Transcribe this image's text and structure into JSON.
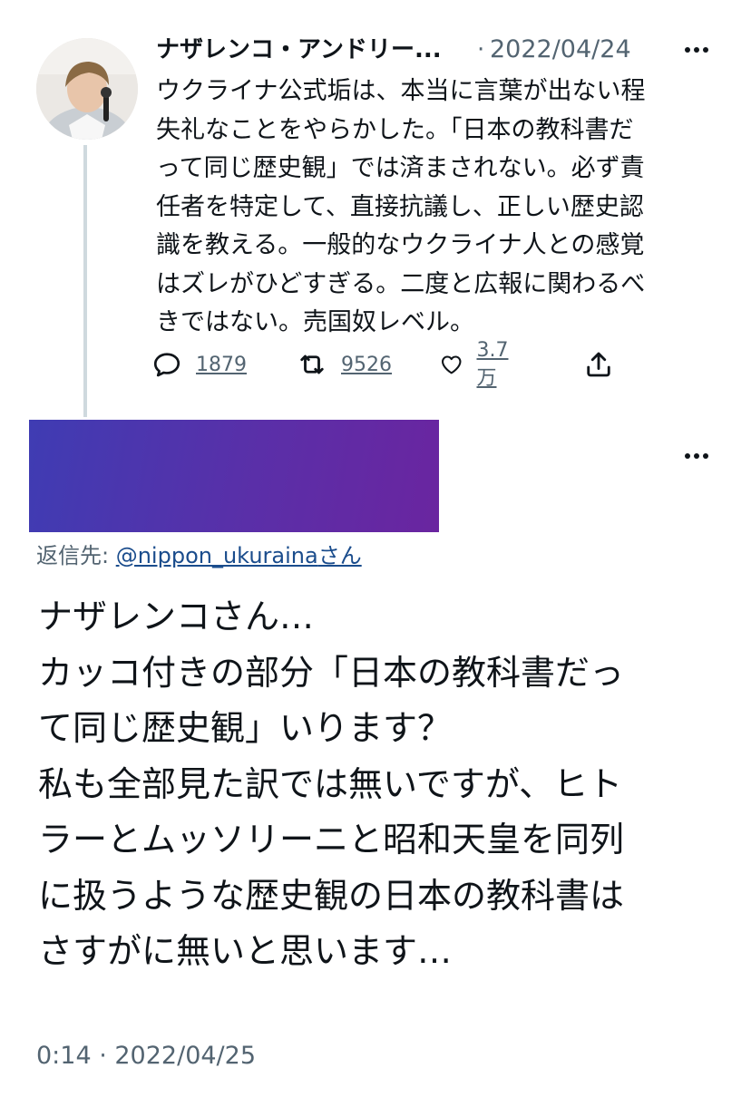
{
  "quoted_tweet": {
    "author_name": "ナザレンコ・アンドリー...",
    "separator": "·",
    "date": "2022/04/24",
    "text": "ウクライナ公式垢は、本当に言葉が出ない程\n失礼なことをやらかした。「日本の教科書だ\nって同じ歴史観」では済まされない。必ず責\n任者を特定して、直接抗議し、正しい歴史認\n識を教える。一般的なウクライナ人との感覚\nはズレがひどすぎる。二度と広報に関わるべ\nきではない。売国奴レベル。",
    "actions": {
      "reply_count": "1879",
      "retweet_count": "9526",
      "like_count": "3.7万"
    }
  },
  "reply_tweet": {
    "reply_to_label": "返信先: ",
    "reply_to_handle": "@nippon_ukuraina",
    "reply_to_suffix": "さん",
    "text": "ナザレンコさん…\nカッコ付きの部分「日本の教科書だっ\nて同じ歴史観」いります？\n私も全部見た訳では無いですが、ヒト\nラーとムッソリーニと昭和天皇を同列\nに扱うような歴史観の日本の教科書は\nさすがに無いと思います…",
    "timestamp": "0:14 · 2022/04/25"
  },
  "colors": {
    "text": "#0f1419",
    "secondary": "#536471",
    "link": "#1a4c8c",
    "banner_start": "#3f3cb3",
    "banner_end": "#6a25a0"
  },
  "icons": [
    "more-icon",
    "reply-icon",
    "retweet-icon",
    "like-icon",
    "share-icon"
  ]
}
